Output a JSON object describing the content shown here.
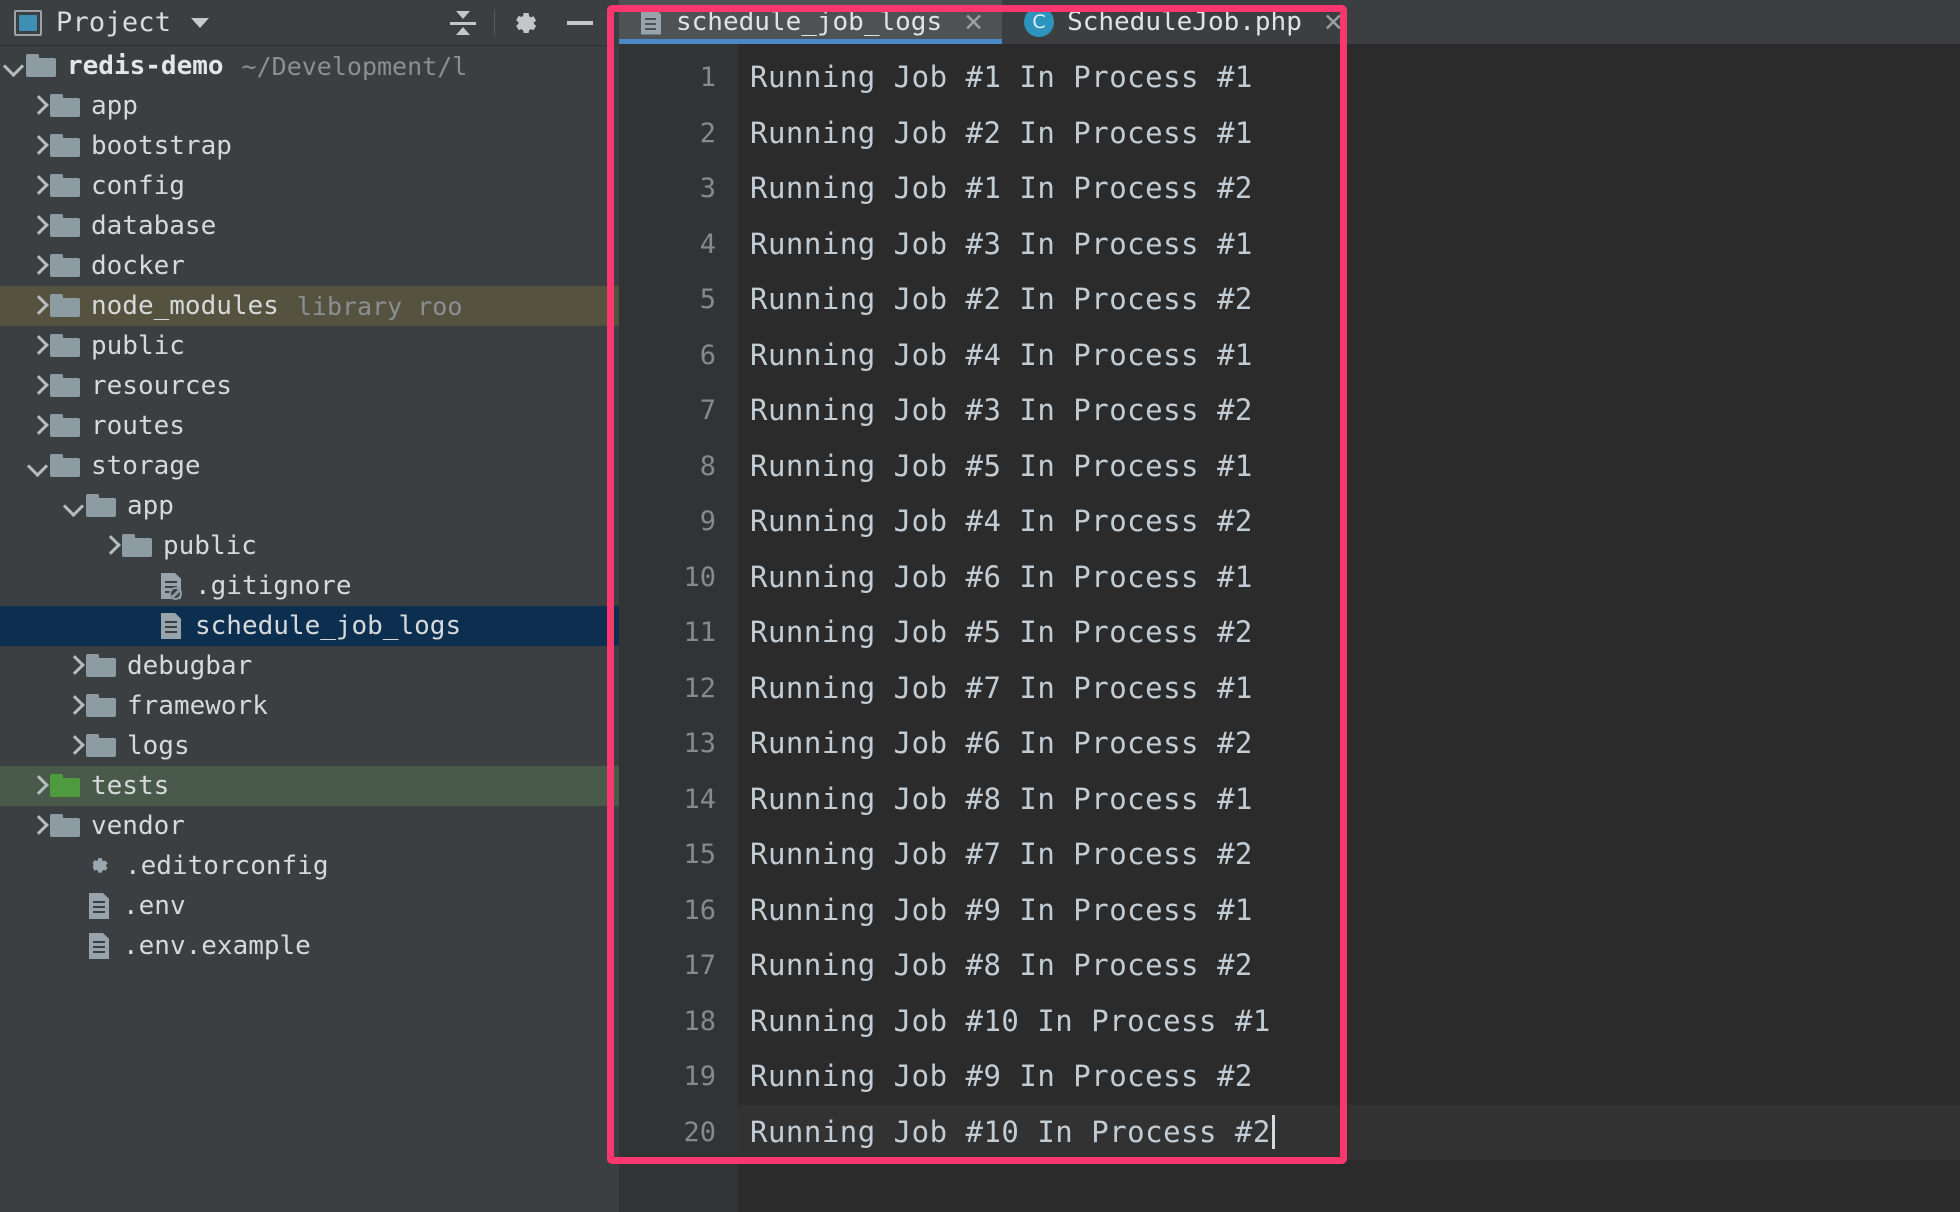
{
  "panel": {
    "title": "Project",
    "icons": {
      "project": "project-window-icon",
      "dropdown": "chevron-down-icon",
      "collapse_all": "collapse-all-icon",
      "settings": "gear-icon",
      "hide": "minimize-icon"
    }
  },
  "tree": [
    {
      "label": "redis-demo",
      "hint": "~/Development/l",
      "type": "folder-root",
      "state": "expanded",
      "indent": 0,
      "bold": true,
      "highlight": "none"
    },
    {
      "label": "app",
      "hint": "",
      "type": "folder",
      "state": "collapsed",
      "indent": 1,
      "bold": false,
      "highlight": "none"
    },
    {
      "label": "bootstrap",
      "hint": "",
      "type": "folder",
      "state": "collapsed",
      "indent": 1,
      "bold": false,
      "highlight": "none"
    },
    {
      "label": "config",
      "hint": "",
      "type": "folder",
      "state": "collapsed",
      "indent": 1,
      "bold": false,
      "highlight": "none"
    },
    {
      "label": "database",
      "hint": "",
      "type": "folder",
      "state": "collapsed",
      "indent": 1,
      "bold": false,
      "highlight": "none"
    },
    {
      "label": "docker",
      "hint": "",
      "type": "folder",
      "state": "collapsed",
      "indent": 1,
      "bold": false,
      "highlight": "none"
    },
    {
      "label": "node_modules",
      "hint": "library roo",
      "type": "folder",
      "state": "collapsed",
      "indent": 1,
      "bold": false,
      "highlight": "library"
    },
    {
      "label": "public",
      "hint": "",
      "type": "folder",
      "state": "collapsed",
      "indent": 1,
      "bold": false,
      "highlight": "none"
    },
    {
      "label": "resources",
      "hint": "",
      "type": "folder",
      "state": "collapsed",
      "indent": 1,
      "bold": false,
      "highlight": "none"
    },
    {
      "label": "routes",
      "hint": "",
      "type": "folder",
      "state": "collapsed",
      "indent": 1,
      "bold": false,
      "highlight": "none"
    },
    {
      "label": "storage",
      "hint": "",
      "type": "folder",
      "state": "expanded",
      "indent": 1,
      "bold": false,
      "highlight": "none"
    },
    {
      "label": "app",
      "hint": "",
      "type": "folder",
      "state": "expanded",
      "indent": 2,
      "bold": false,
      "highlight": "none"
    },
    {
      "label": "public",
      "hint": "",
      "type": "folder",
      "state": "collapsed",
      "indent": 3,
      "bold": false,
      "highlight": "none"
    },
    {
      "label": ".gitignore",
      "hint": "",
      "type": "file-ignored",
      "state": "leaf",
      "indent": 4,
      "bold": false,
      "highlight": "none"
    },
    {
      "label": "schedule_job_logs",
      "hint": "",
      "type": "file",
      "state": "leaf",
      "indent": 4,
      "bold": false,
      "highlight": "selected"
    },
    {
      "label": "debugbar",
      "hint": "",
      "type": "folder",
      "state": "collapsed",
      "indent": 2,
      "bold": false,
      "highlight": "none"
    },
    {
      "label": "framework",
      "hint": "",
      "type": "folder",
      "state": "collapsed",
      "indent": 2,
      "bold": false,
      "highlight": "none"
    },
    {
      "label": "logs",
      "hint": "",
      "type": "folder",
      "state": "collapsed",
      "indent": 2,
      "bold": false,
      "highlight": "none"
    },
    {
      "label": "tests",
      "hint": "",
      "type": "folder-green",
      "state": "collapsed",
      "indent": 1,
      "bold": false,
      "highlight": "green"
    },
    {
      "label": "vendor",
      "hint": "",
      "type": "folder",
      "state": "collapsed",
      "indent": 1,
      "bold": false,
      "highlight": "none"
    },
    {
      "label": ".editorconfig",
      "hint": "",
      "type": "settings-file",
      "state": "leaf",
      "indent": 2,
      "bold": false,
      "highlight": "none"
    },
    {
      "label": ".env",
      "hint": "",
      "type": "file",
      "state": "leaf",
      "indent": 2,
      "bold": false,
      "highlight": "none"
    },
    {
      "label": ".env.example",
      "hint": "",
      "type": "file",
      "state": "leaf",
      "indent": 2,
      "bold": false,
      "highlight": "none"
    }
  ],
  "tabs": [
    {
      "label": "schedule_job_logs",
      "icon": "text-file-icon",
      "active": true,
      "close": "✕"
    },
    {
      "label": "ScheduleJob.php",
      "icon": "php-class-icon",
      "active": false,
      "close": "✕"
    }
  ],
  "editor": {
    "line_numbers": [
      "1",
      "2",
      "3",
      "4",
      "5",
      "6",
      "7",
      "8",
      "9",
      "10",
      "11",
      "12",
      "13",
      "14",
      "15",
      "16",
      "17",
      "18",
      "19",
      "20"
    ],
    "lines": [
      "Running Job #1 In Process #1",
      "Running Job #2 In Process #1",
      "Running Job #1 In Process #2",
      "Running Job #3 In Process #1",
      "Running Job #2 In Process #2",
      "Running Job #4 In Process #1",
      "Running Job #3 In Process #2",
      "Running Job #5 In Process #1",
      "Running Job #4 In Process #2",
      "Running Job #6 In Process #1",
      "Running Job #5 In Process #2",
      "Running Job #7 In Process #1",
      "Running Job #6 In Process #2",
      "Running Job #8 In Process #1",
      "Running Job #7 In Process #2",
      "Running Job #9 In Process #1",
      "Running Job #8 In Process #2",
      "Running Job #10 In Process #1",
      "Running Job #9 In Process #2",
      "Running Job #10 In Process #2"
    ],
    "caret_line": 20
  },
  "annotation": {
    "color": "#f9376f",
    "shape": "rectangle-highlight"
  },
  "colors": {
    "sidebar_bg": "#3c3f41",
    "editor_bg": "#2b2b2b",
    "gutter_bg": "#313335",
    "tab_active_bg": "#4e5254",
    "tab_underline": "#4a88c7",
    "selected_row": "#0d2f4f",
    "library_row": "#55523f",
    "green_row": "#4a5a4a",
    "accent_pink": "#f9376f"
  }
}
